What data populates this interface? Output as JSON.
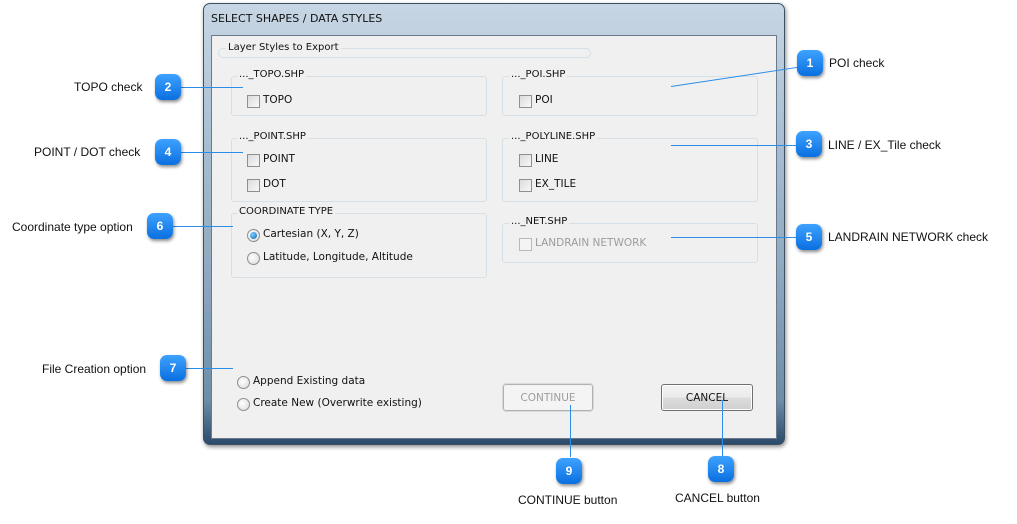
{
  "window": {
    "title": "SELECT SHAPES / DATA STYLES",
    "outer_group_label": "Layer Styles to Export"
  },
  "groups": {
    "topo": {
      "label": "..._TOPO.SHP",
      "items": [
        {
          "label": "TOPO",
          "checked": false,
          "enabled": true
        }
      ]
    },
    "poi": {
      "label": "..._POI.SHP",
      "items": [
        {
          "label": "POI",
          "checked": false,
          "enabled": true
        }
      ]
    },
    "point": {
      "label": "..._POINT.SHP",
      "items": [
        {
          "label": "POINT",
          "checked": false,
          "enabled": true
        },
        {
          "label": "DOT",
          "checked": false,
          "enabled": true
        }
      ]
    },
    "polyline": {
      "label": "..._POLYLINE.SHP",
      "items": [
        {
          "label": "LINE",
          "checked": false,
          "enabled": true
        },
        {
          "label": "EX_TILE",
          "checked": false,
          "enabled": true
        }
      ]
    },
    "coordinate": {
      "label": "COORDINATE TYPE",
      "options": [
        {
          "label": "Cartesian (X, Y, Z)",
          "selected": true
        },
        {
          "label": "Latitude, Longitude, Altitude",
          "selected": false
        }
      ]
    },
    "net": {
      "label": "..._NET.SHP",
      "items": [
        {
          "label": "LANDRAIN NETWORK",
          "checked": false,
          "enabled": false
        }
      ]
    }
  },
  "file_creation": {
    "options": [
      {
        "label": "Append Existing data",
        "selected": false
      },
      {
        "label": "Create New (Overwrite existing)",
        "selected": false
      }
    ]
  },
  "buttons": {
    "continue": {
      "label": "CONTINUE",
      "enabled": false
    },
    "cancel": {
      "label": "CANCEL",
      "enabled": true
    }
  },
  "callouts": [
    {
      "number": "1",
      "text": "POI check"
    },
    {
      "number": "2",
      "text": "TOPO check"
    },
    {
      "number": "3",
      "text": "LINE / EX_Tile check"
    },
    {
      "number": "4",
      "text": "POINT / DOT check"
    },
    {
      "number": "5",
      "text": "LANDRAIN NETWORK check"
    },
    {
      "number": "6",
      "text": "Coordinate type option"
    },
    {
      "number": "7",
      "text": "File Creation option"
    },
    {
      "number": "8",
      "text": "CANCEL button"
    },
    {
      "number": "9",
      "text": "CONTINUE button"
    }
  ],
  "colors": {
    "callout_blue": "#1a82f0",
    "leader_line": "#2a8ee8"
  }
}
